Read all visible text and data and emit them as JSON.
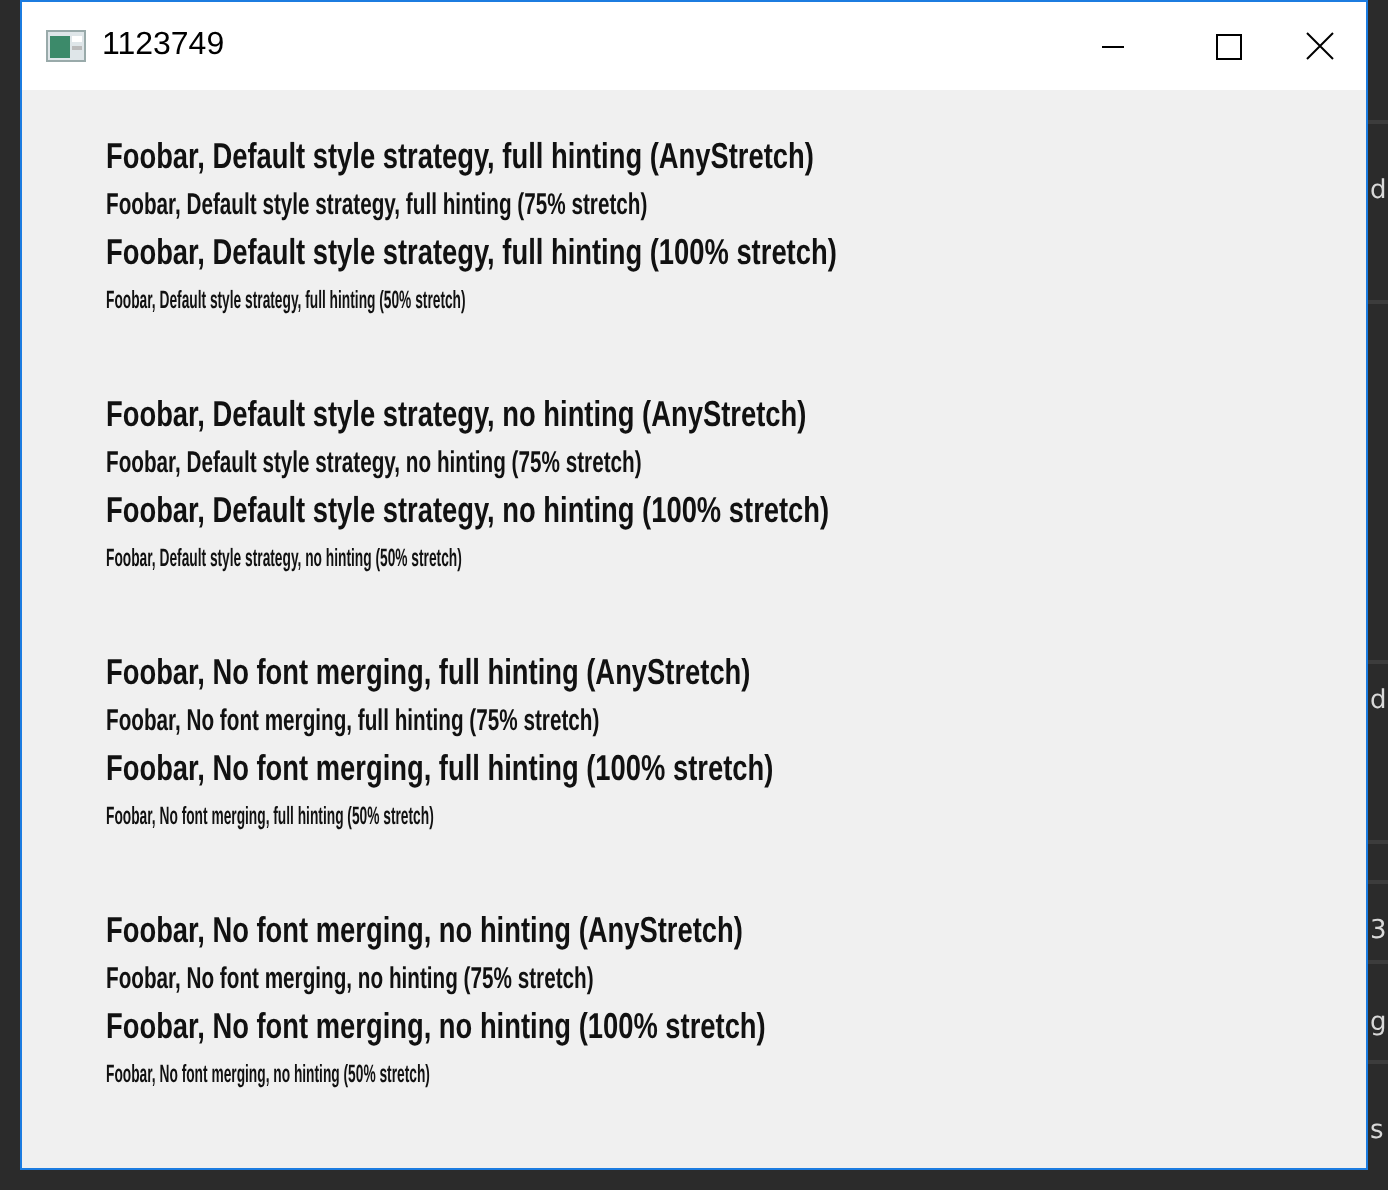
{
  "background": {
    "fragments": [
      {
        "text": "d"
      },
      {
        "text": "d"
      },
      {
        "text": "3"
      },
      {
        "text": "g"
      },
      {
        "text": "s"
      }
    ]
  },
  "window": {
    "title": "1123749"
  },
  "groups": [
    {
      "lines": [
        {
          "text": "Foobar, Default style strategy, full hinting (AnyStretch)",
          "kind": "any"
        },
        {
          "text": "Foobar, Default style strategy, full hinting (75% stretch)",
          "kind": "three-quarter"
        },
        {
          "text": "Foobar, Default style strategy, full hinting (100% stretch)",
          "kind": "full"
        },
        {
          "text": "Foobar, Default style strategy, full hinting (50% stretch)",
          "kind": "half"
        }
      ]
    },
    {
      "lines": [
        {
          "text": "Foobar, Default style strategy, no hinting (AnyStretch)",
          "kind": "any"
        },
        {
          "text": "Foobar, Default style strategy, no hinting (75% stretch)",
          "kind": "three-quarter"
        },
        {
          "text": "Foobar, Default style strategy, no hinting (100% stretch)",
          "kind": "full"
        },
        {
          "text": "Foobar, Default style strategy, no hinting (50% stretch)",
          "kind": "half"
        }
      ]
    },
    {
      "lines": [
        {
          "text": "Foobar, No font merging, full hinting (AnyStretch)",
          "kind": "any"
        },
        {
          "text": "Foobar, No font merging, full hinting (75% stretch)",
          "kind": "three-quarter"
        },
        {
          "text": "Foobar, No font merging, full hinting (100% stretch)",
          "kind": "full"
        },
        {
          "text": "Foobar, No font merging, full hinting (50% stretch)",
          "kind": "half"
        }
      ]
    },
    {
      "lines": [
        {
          "text": "Foobar, No font merging, no hinting (AnyStretch)",
          "kind": "any"
        },
        {
          "text": "Foobar, No font merging, no hinting (75% stretch)",
          "kind": "three-quarter"
        },
        {
          "text": "Foobar, No font merging, no hinting (100% stretch)",
          "kind": "full"
        },
        {
          "text": "Foobar, No font merging, no hinting (50% stretch)",
          "kind": "half"
        }
      ]
    }
  ]
}
